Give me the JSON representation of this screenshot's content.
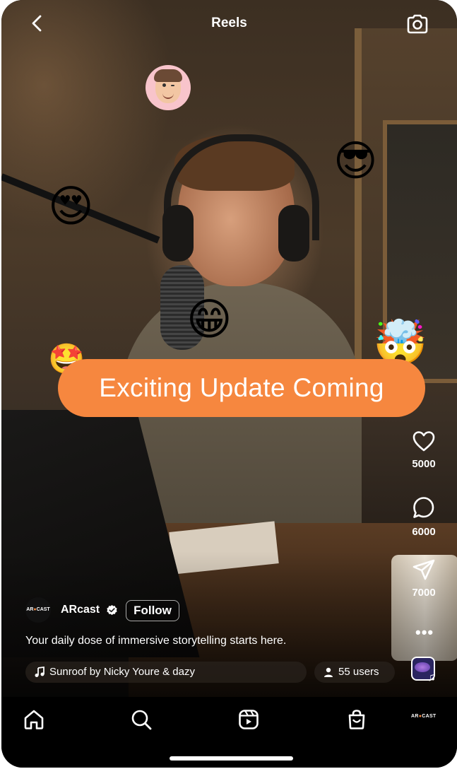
{
  "header": {
    "title": "Reels",
    "back_icon": "chevron-left-icon",
    "camera_icon": "camera-icon"
  },
  "overlay": {
    "emojis": {
      "avatar": "memoji-winking-avatar",
      "sunglasses": "😎",
      "heart_eyes": "😍",
      "grin": "😁",
      "star_struck": "🤩",
      "mind_blown": "🤯"
    },
    "banner_text": "Exciting Update Coming",
    "banner_color": "#f6873f"
  },
  "actions": {
    "like_count": "5000",
    "comment_count": "6000",
    "share_count": "7000",
    "more_label": "•••"
  },
  "post": {
    "account_logo_text": "AR",
    "account_logo_accent": "●",
    "account_logo_suffix": "CAST",
    "account_name": "ARcast",
    "follow_label": "Follow",
    "caption": "Your daily dose of immersive storytelling starts here.",
    "music_label": "Sunroof by Nicky Youre & dazy",
    "users_label": "55 users"
  },
  "nav": {
    "items": [
      "home-icon",
      "search-icon",
      "reels-icon",
      "shop-icon",
      "profile-logo"
    ],
    "profile_logo_text": "AR",
    "profile_logo_accent": "●",
    "profile_logo_suffix": "CAST"
  }
}
